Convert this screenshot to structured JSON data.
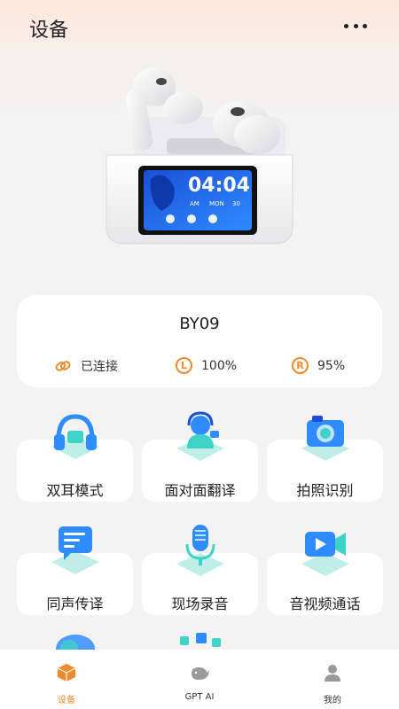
{
  "header": {
    "title": "设备",
    "more_icon": "more-dots-icon"
  },
  "product": {
    "image": "earbuds-case-illustration",
    "screen_time": "04:04",
    "screen_day": "AM",
    "screen_weekday": "MON",
    "screen_date": "30"
  },
  "device": {
    "name": "BY09",
    "status": {
      "icon": "link-icon",
      "text": "已连接"
    },
    "left": {
      "icon_letter": "L",
      "battery": "100%"
    },
    "right": {
      "icon_letter": "R",
      "battery": "95%"
    }
  },
  "features": [
    {
      "label": "双耳模式",
      "icon": "headphones-icon"
    },
    {
      "label": "面对面翻译",
      "icon": "translator-person-icon"
    },
    {
      "label": "拍照识别",
      "icon": "camera-icon"
    },
    {
      "label": "同声传译",
      "icon": "chat-bubble-icon"
    },
    {
      "label": "现场录音",
      "icon": "microphone-icon"
    },
    {
      "label": "音视频通话",
      "icon": "video-call-icon"
    }
  ],
  "nav": [
    {
      "label": "设备",
      "icon": "box-icon",
      "active": true
    },
    {
      "label": "GPT AI",
      "icon": "whale-icon",
      "active": false
    },
    {
      "label": "我的",
      "icon": "user-icon",
      "active": false
    }
  ],
  "colors": {
    "accent": "#f08a2a",
    "background": "#f3f3f3",
    "card": "#ffffff",
    "feature_blue": "#2f8cff",
    "feature_teal": "#3fd2c7"
  }
}
